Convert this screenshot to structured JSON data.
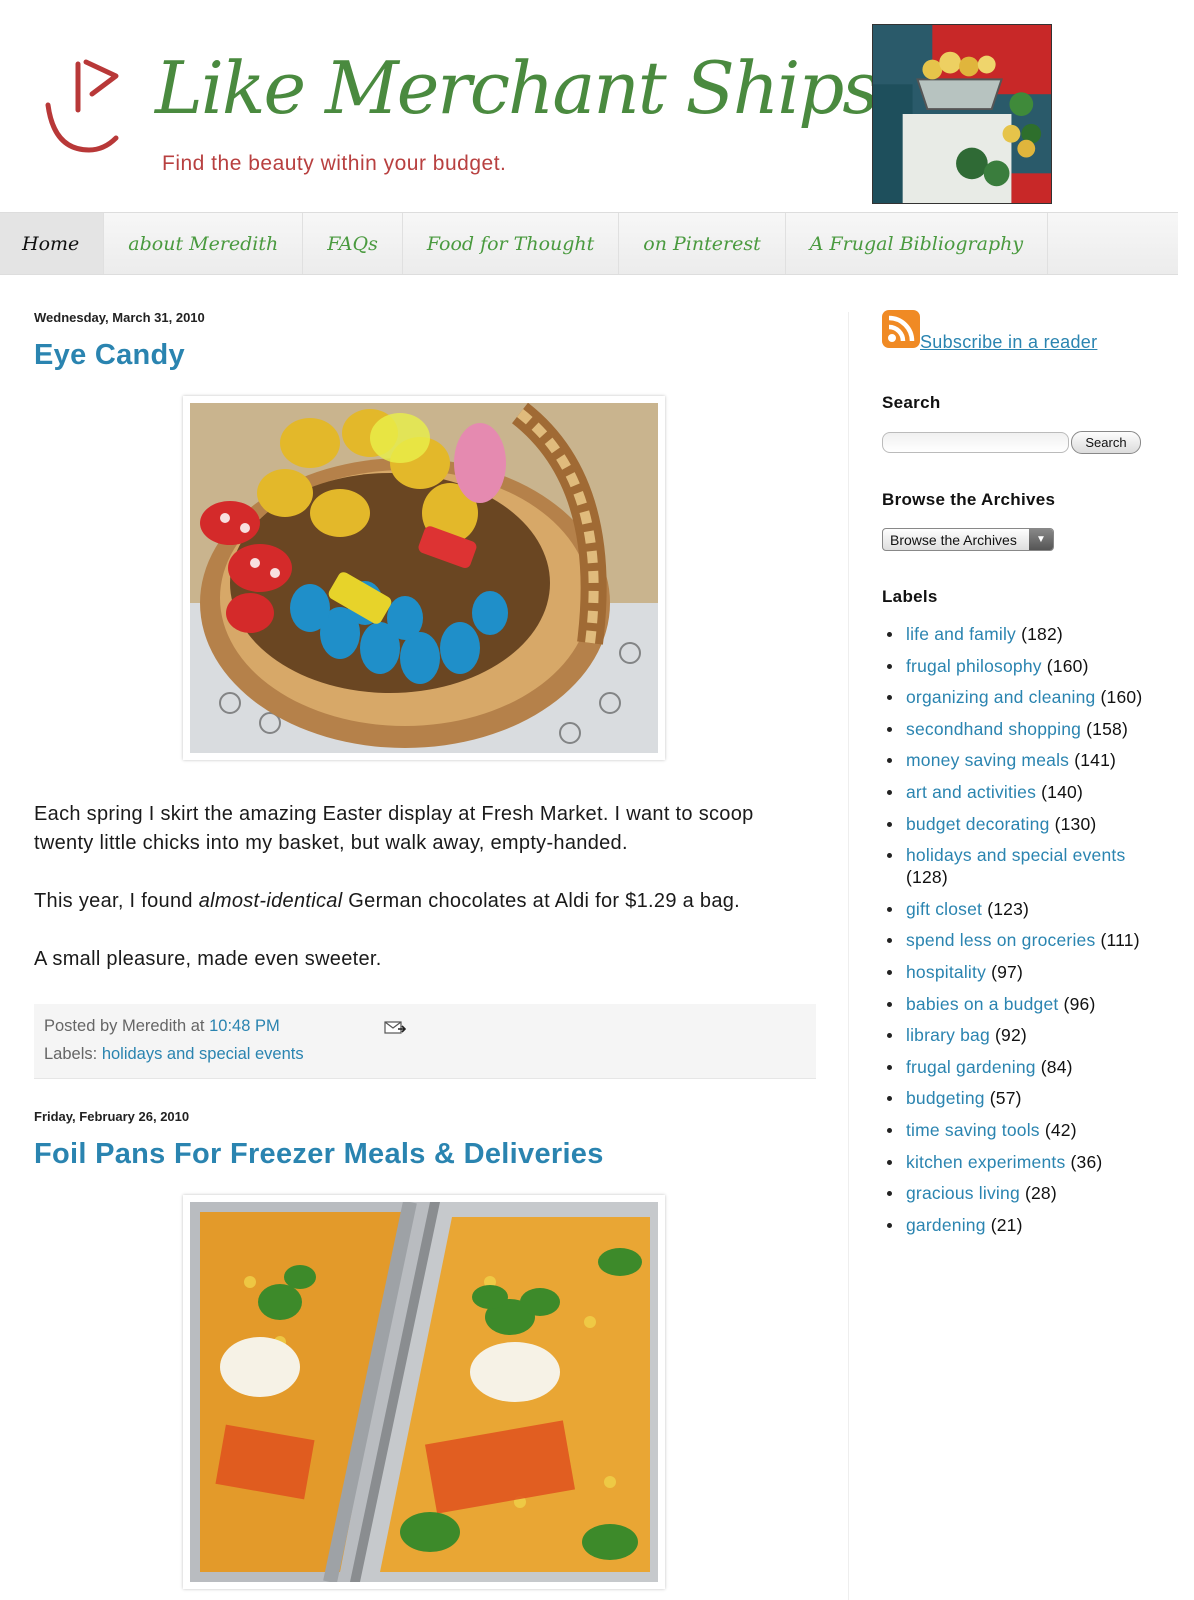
{
  "header": {
    "title": "Like Merchant Ships",
    "tagline": "Find the beauty within your budget."
  },
  "nav": {
    "items": [
      {
        "label": "Home"
      },
      {
        "label": "about Meredith"
      },
      {
        "label": "FAQs"
      },
      {
        "label": "Food for Thought"
      },
      {
        "label": "on Pinterest"
      },
      {
        "label": "A Frugal Bibliography"
      }
    ]
  },
  "posts": [
    {
      "date": "Wednesday, March 31, 2010",
      "title": "Eye Candy",
      "paragraphs": [
        "Each spring I skirt the amazing Easter display at Fresh Market. I want to scoop twenty little chicks into my basket, but walk away, empty-handed.",
        "German chocolates at Aldi for $1.29 a bag.",
        "A small pleasure, made even sweeter."
      ],
      "p2_prefix": "This year, I found",
      "p2_emphasis": "almost-identical",
      "posted_by": "Posted by Meredith at",
      "time": "10:48 PM",
      "labels_prefix": "Labels:",
      "label": "holidays and special events"
    },
    {
      "date": "Friday, February 26, 2010",
      "title": "Foil Pans For Freezer Meals & Deliveries"
    }
  ],
  "sidebar": {
    "subscribe": "Subscribe in a reader",
    "search_title": "Search",
    "search_button": "Search",
    "search_value": "",
    "archive_title": "Browse the Archives",
    "archive_selected": "Browse the Archives",
    "labels_title": "Labels",
    "labels": [
      {
        "name": "life and family",
        "count": "(182)"
      },
      {
        "name": "frugal philosophy",
        "count": "(160)"
      },
      {
        "name": "organizing and cleaning",
        "count": "(160)"
      },
      {
        "name": "secondhand shopping",
        "count": "(158)"
      },
      {
        "name": "money saving meals",
        "count": "(141)"
      },
      {
        "name": "art and activities",
        "count": "(140)"
      },
      {
        "name": "budget decorating",
        "count": "(130)"
      },
      {
        "name": "holidays and special events",
        "count": "(128)"
      },
      {
        "name": "gift closet",
        "count": "(123)"
      },
      {
        "name": "spend less on groceries",
        "count": "(111)"
      },
      {
        "name": "hospitality",
        "count": "(97)"
      },
      {
        "name": "babies on a budget",
        "count": "(96)"
      },
      {
        "name": "library bag",
        "count": "(92)"
      },
      {
        "name": "frugal gardening",
        "count": "(84)"
      },
      {
        "name": "budgeting",
        "count": "(57)"
      },
      {
        "name": "time saving tools",
        "count": "(42)"
      },
      {
        "name": "kitchen experiments",
        "count": "(36)"
      },
      {
        "name": "gracious living",
        "count": "(28)"
      },
      {
        "name": "gardening",
        "count": "(21)"
      }
    ]
  },
  "colors": {
    "title_green": "#4a8a3f",
    "tagline_red": "#b84040",
    "link_blue": "#2a84b0"
  }
}
